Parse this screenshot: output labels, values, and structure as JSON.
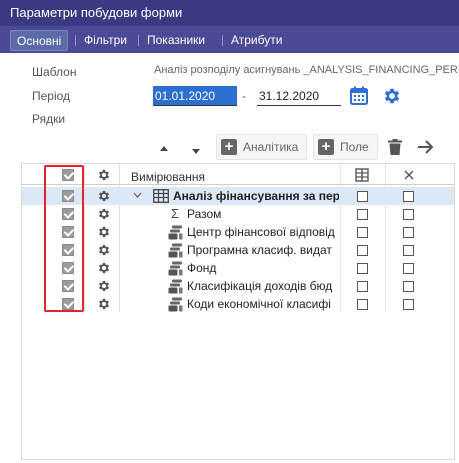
{
  "window": {
    "title": "Параметри побудови форми"
  },
  "tabs": [
    {
      "label": "Основні",
      "active": true
    },
    {
      "label": "Фільтри",
      "active": false
    },
    {
      "label": "Показники",
      "active": false
    },
    {
      "label": "Атрибути",
      "active": false
    }
  ],
  "form": {
    "template_label": "Шаблон",
    "template_value": "Аналіз розподілу асигнувань _ANALYSIS_FINANCING_PERIOD",
    "period_label": "Період",
    "period_from": "01.01.2020",
    "period_dash": "-",
    "period_to": "31.12.2020",
    "rows_label": "Рядки"
  },
  "toolbar": {
    "analytics_label": "Аналітика",
    "field_label": "Поле"
  },
  "grid": {
    "header_label": "Вимірювання",
    "rows": [
      {
        "label": "Аналіз фінансування за пері",
        "icon": "table-icon",
        "checked": true,
        "col1": false,
        "col2": false
      },
      {
        "label": "Разом",
        "icon": "sigma-icon",
        "checked": true,
        "col1": false,
        "col2": false
      },
      {
        "label": "Центр фінансової відповід",
        "icon": "dimension-icon",
        "checked": true,
        "col1": false,
        "col2": false
      },
      {
        "label": "Програмна класиф. видат",
        "icon": "dimension-icon",
        "checked": true,
        "col1": false,
        "col2": false
      },
      {
        "label": "Фонд",
        "icon": "dimension-icon",
        "checked": true,
        "col1": false,
        "col2": false
      },
      {
        "label": "Класифікація доходів бюд",
        "icon": "dimension-icon",
        "checked": true,
        "col1": false,
        "col2": false
      },
      {
        "label": "Коди економічної класифі",
        "icon": "dimension-icon",
        "checked": true,
        "col1": false,
        "col2": false
      }
    ]
  },
  "colors": {
    "title_bg": "#3a3a82",
    "tab_bg": "#4a4a96",
    "accent_blue": "#2d6fd0",
    "row_highlight": "#dce8f6",
    "annotation_red": "#e0262c"
  }
}
